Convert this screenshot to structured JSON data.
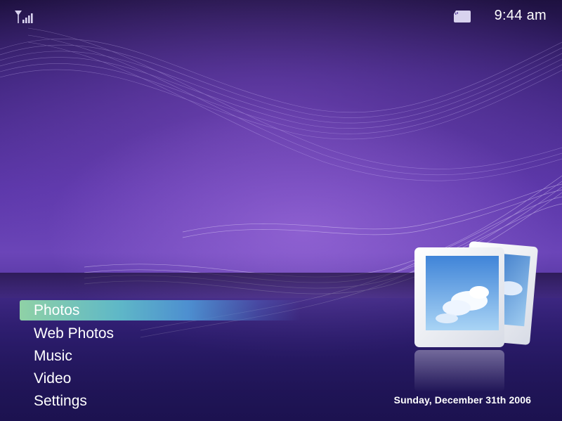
{
  "status_bar": {
    "signal_icon": "signal-strength-icon",
    "storage_icon": "memory-card-icon",
    "time": "9:44 am"
  },
  "menu": {
    "selected_index": 0,
    "items": [
      {
        "label": "Photos"
      },
      {
        "label": "Web Photos"
      },
      {
        "label": "Music"
      },
      {
        "label": "Video"
      },
      {
        "label": "Settings"
      }
    ]
  },
  "preview": {
    "icon": "photos-stack-icon"
  },
  "date": "Sunday, December 31th 2006",
  "colors": {
    "accent_start": "#8fd1a6",
    "accent_end": "#4d8fd0",
    "background": "#5a36a8",
    "text": "#ffffff"
  }
}
